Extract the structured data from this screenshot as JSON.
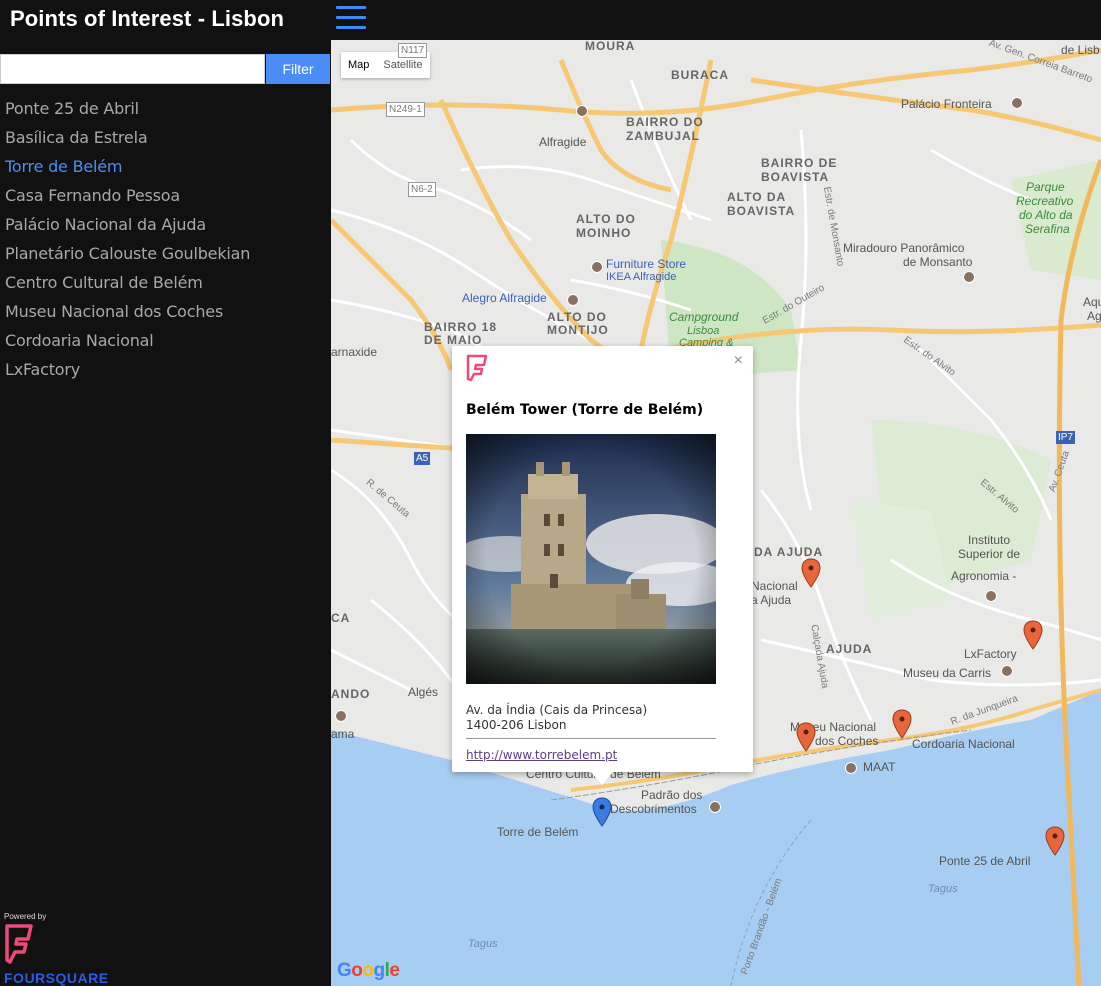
{
  "header": {
    "title": "Points of Interest - Lisbon"
  },
  "sidebar": {
    "filter_placeholder": "",
    "filter_value": "",
    "filter_button": "Filter",
    "items": [
      {
        "label": "Ponte 25 de Abril",
        "active": false
      },
      {
        "label": "Basílica da Estrela",
        "active": false
      },
      {
        "label": "Torre de Belém",
        "active": true
      },
      {
        "label": "Casa Fernando Pessoa",
        "active": false
      },
      {
        "label": "Palácio Nacional da Ajuda",
        "active": false
      },
      {
        "label": "Planetário Calouste Goulbekian",
        "active": false
      },
      {
        "label": "Centro Cultural de Belém",
        "active": false
      },
      {
        "label": "Museu Nacional dos Coches",
        "active": false
      },
      {
        "label": "Cordoaria Nacional",
        "active": false
      },
      {
        "label": "LxFactory",
        "active": false
      }
    ],
    "powered_by": "Powered by",
    "brand": "FOURSQUARE"
  },
  "map": {
    "type_map": "Map",
    "type_satellite": "Satellite",
    "selected_type": "Map",
    "labels": {
      "moura": "MOURA",
      "buraca": "BURACA",
      "palacio_fronteira": "Palácio Fronteira",
      "av_gen": "Av. Gen. Correia Barreto",
      "bairro_zambujal_1": "BAIRRO DO",
      "bairro_zambujal_2": "ZAMBUJAL",
      "alfragide": "Alfragide",
      "bairro_boavista_1": "BAIRRO DE",
      "bairro_boavista_2": "BOAVISTA",
      "alto_boavista_1": "ALTO DA",
      "alto_boavista_2": "BOAVISTA",
      "parque_1": "Parque",
      "parque_2": "Recreativo",
      "parque_3": "do Alto da",
      "parque_4": "Serafina",
      "alto_moinho_1": "ALTO DO",
      "alto_moinho_2": "MOINHO",
      "miradouro_1": "Miradouro Panorâmico",
      "miradouro_2": "de Monsanto",
      "furniture_1": "Furniture Store",
      "furniture_2": "IKEA Alfragide",
      "alegro": "Alegro Alfragide",
      "alto_montijo_1": "ALTO DO",
      "alto_montijo_2": "MONTIJO",
      "bairro18_1": "BAIRRO 18",
      "bairro18_2": "DE MAIO",
      "campground_1": "Campground",
      "campground_2": "Lisboa",
      "campground_3": "Camping &",
      "carnaxide": "arnaxide",
      "da_ajuda": "DA AJUDA",
      "nacional_ajuda_1": "Nacional",
      "nacional_ajuda_2": "a Ajuda",
      "instituto_1": "Instituto",
      "instituto_2": "Superior de",
      "instituto_3": "Agronomia -",
      "ajuda": "AJUDA",
      "lxfactory": "LxFactory",
      "museu_carris": "Museu da Carris",
      "museu_coches_1": "Museu Nacional",
      "museu_coches_2": "dos Coches",
      "cordoaria": "Cordoaria Nacional",
      "maat": "MAAT",
      "centro_cultural": "Centro Cultural de Belém",
      "padrao_1": "Padrão dos",
      "padrao_2": "Descobrimentos",
      "torre_belem": "Torre de Belém",
      "ponte25": "Ponte 25 de Abril",
      "tagus_1": "Tagus",
      "tagus_2": "Tagus",
      "alges": "Algés",
      "ama": "ama",
      "ando": "ANDO",
      "ca": "CA",
      "aqu_1": "Aqu",
      "aqu_2": "Ag",
      "de_lisb_1": "de Lisb",
      "cordoaria_road": "Av. Gen.",
      "estr_monsanto": "Estr. de Monsanto",
      "estr_outeiro": "Estr. do Outeiro",
      "estr_alvito": "Estr. do Alvito",
      "estr_alvito2": "Estr. Alvito",
      "calcada_ajuda": "Calçada Ajuda",
      "r_junqueira": "R. da Junqueira",
      "av_ceuta": "Av. Ceuta",
      "r_ceuta": "R. de Ceuta",
      "porto_brandao": "Porto Brandão - Belém",
      "n117": "N117",
      "n249": "N249-1",
      "n6": "N6-2",
      "a5": "A5",
      "ip7": "IP7"
    }
  },
  "infowindow": {
    "title": "Belém Tower (Torre de Belém)",
    "address_line1": "Av. da Índia (Cais da Princesa)",
    "address_line2": "1400-206 Lisbon",
    "url": "http://www.torrebelem.pt",
    "close": "×"
  },
  "google_logo": "Google",
  "colors": {
    "accent": "#4a8df7",
    "marker_default": "#e8663c",
    "marker_selected": "#3b7ae0",
    "water": "#a7cdf2",
    "road_major": "#f7c873"
  }
}
